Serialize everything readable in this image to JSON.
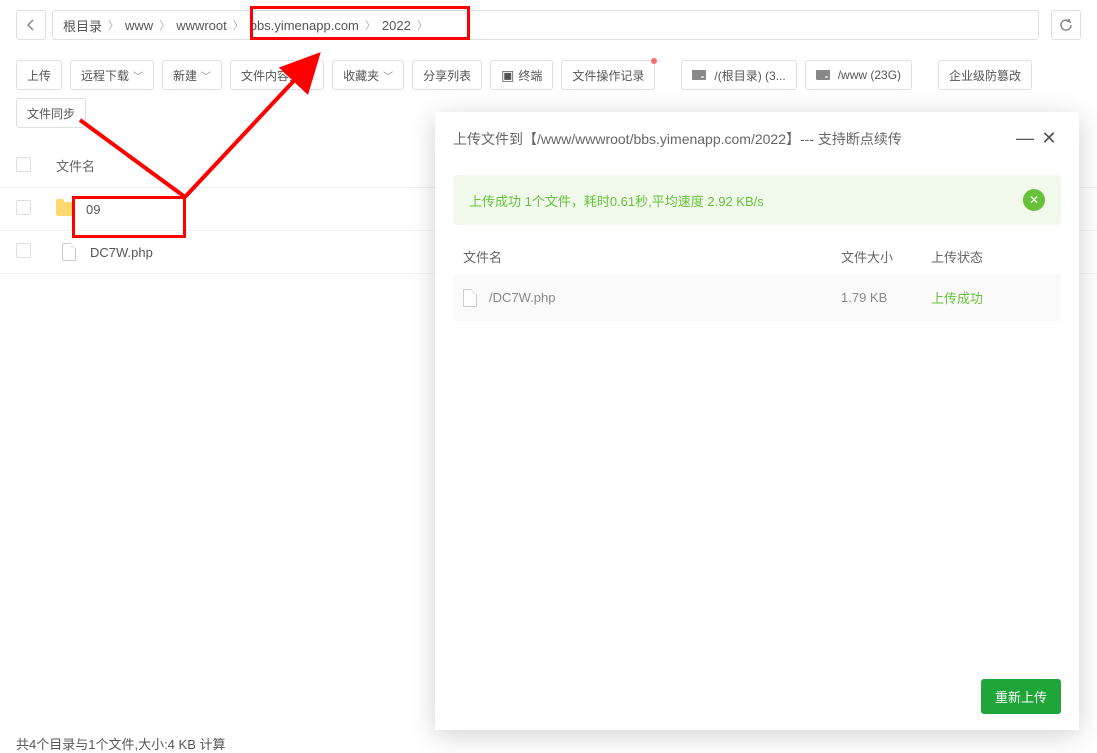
{
  "breadcrumb": {
    "segments": [
      "根目录",
      "www",
      "wwwroot",
      "bbs.yimenapp.com",
      "2022"
    ]
  },
  "toolbar": {
    "upload": "上传",
    "remote_dl": "远程下载",
    "new_menu": "新建",
    "content_search": "文件内容查找",
    "favorites": "收藏夹",
    "share_list": "分享列表",
    "terminal": "终端",
    "file_op_log": "文件操作记录",
    "disk_root": "/(根目录) (3...",
    "disk_www": "/www (23G)",
    "anti_tamper": "企业级防篡改",
    "file_sync": "文件同步"
  },
  "list": {
    "header_filename": "文件名",
    "rows": [
      {
        "type": "folder",
        "name": "09"
      },
      {
        "type": "file",
        "name": "DC7W.php"
      }
    ]
  },
  "modal": {
    "title": "上传文件到【/www/wwwroot/bbs.yimenapp.com/2022】--- 支持断点续传",
    "success_msg": "上传成功 1个文件，耗时0.61秒,平均速度 2.92 KB/s",
    "col_name": "文件名",
    "col_size": "文件大小",
    "col_status": "上传状态",
    "rows": [
      {
        "name": "/DC7W.php",
        "size": "1.79 KB",
        "status": "上传成功"
      }
    ],
    "reupload": "重新上传"
  },
  "footer": {
    "clipped": "共4个目录与1个文件,大小:4 KB  计算"
  }
}
